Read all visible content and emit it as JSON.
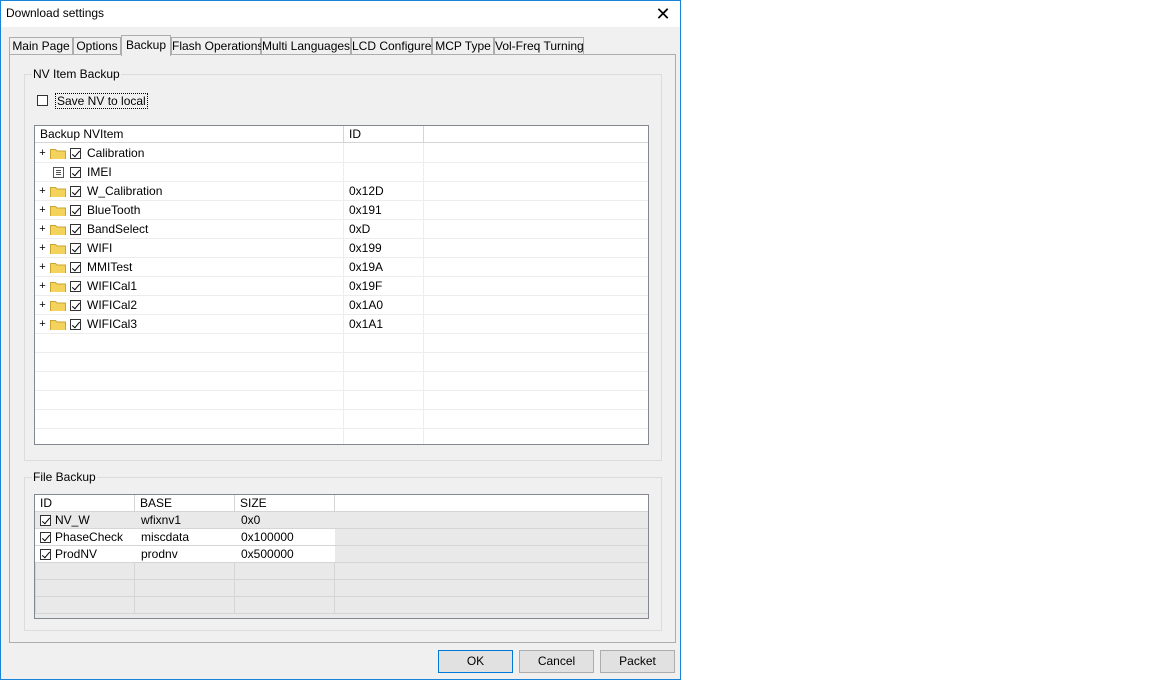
{
  "window": {
    "title": "Download settings"
  },
  "tabs": [
    {
      "label": "Main Page"
    },
    {
      "label": "Options"
    },
    {
      "label": "Backup"
    },
    {
      "label": "Flash Operations"
    },
    {
      "label": "Multi Languages"
    },
    {
      "label": "LCD Configure"
    },
    {
      "label": "MCP Type"
    },
    {
      "label": "Vol-Freq Turning"
    }
  ],
  "nv_backup": {
    "group_label": "NV Item Backup",
    "save_nv_label": "Save NV to local",
    "save_nv_checked": false,
    "columns": [
      "Backup NVItem",
      "ID",
      ""
    ],
    "items": [
      {
        "name": "Calibration",
        "id": "",
        "checked": true,
        "type": "folder"
      },
      {
        "name": "IMEI",
        "id": "",
        "checked": true,
        "type": "leaf"
      },
      {
        "name": "W_Calibration",
        "id": "0x12D",
        "checked": true,
        "type": "folder"
      },
      {
        "name": "BlueTooth",
        "id": "0x191",
        "checked": true,
        "type": "folder"
      },
      {
        "name": "BandSelect",
        "id": "0xD",
        "checked": true,
        "type": "folder"
      },
      {
        "name": "WIFI",
        "id": "0x199",
        "checked": true,
        "type": "folder"
      },
      {
        "name": "MMITest",
        "id": "0x19A",
        "checked": true,
        "type": "folder"
      },
      {
        "name": "WIFICal1",
        "id": "0x19F",
        "checked": true,
        "type": "folder"
      },
      {
        "name": "WIFICal2",
        "id": "0x1A0",
        "checked": true,
        "type": "folder"
      },
      {
        "name": "WIFICal3",
        "id": "0x1A1",
        "checked": true,
        "type": "folder"
      }
    ]
  },
  "file_backup": {
    "group_label": "File Backup",
    "columns": [
      "ID",
      "BASE",
      "SIZE",
      ""
    ],
    "rows": [
      {
        "id": "NV_W",
        "base": "wfixnv1",
        "size": "0x0",
        "checked": true
      },
      {
        "id": "PhaseCheck",
        "base": "miscdata",
        "size": "0x100000",
        "checked": true
      },
      {
        "id": "ProdNV",
        "base": "prodnv",
        "size": "0x500000",
        "checked": true
      }
    ]
  },
  "buttons": {
    "ok": "OK",
    "cancel": "Cancel",
    "packet": "Packet"
  },
  "icons": {
    "close": "close-icon",
    "folder": "folder-icon",
    "expand": "plus-expander-icon",
    "leaf": "document-icon"
  },
  "colors": {
    "window_border": "#1883d7",
    "folder": "#f3d35b",
    "face": "#f0f0f0"
  }
}
